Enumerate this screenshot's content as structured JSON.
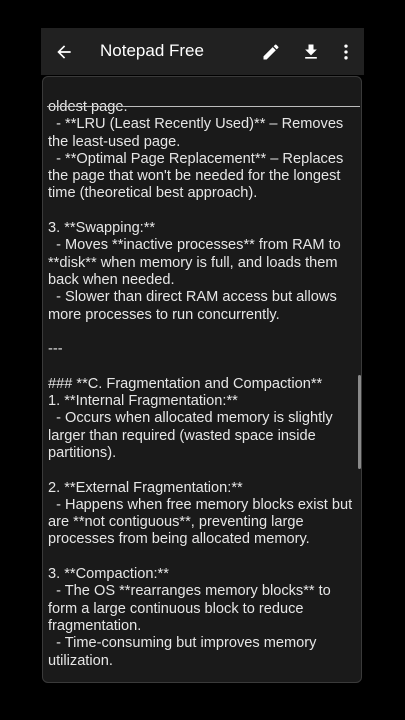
{
  "app_bar": {
    "title": "Notepad Free",
    "icons": {
      "back": "arrow-back-icon",
      "edit": "pencil-icon",
      "download": "download-icon",
      "more": "more-vertical-icon"
    }
  },
  "note": {
    "content": "oldest page.\n  - **LRU (Least Recently Used)** – Removes the least-used page.\n  - **Optimal Page Replacement** – Replaces the page that won't be needed for the longest time (theoretical best approach).\n\n3. **Swapping:**\n  - Moves **inactive processes** from RAM to **disk** when memory is full, and loads them back when needed.\n  - Slower than direct RAM access but allows more processes to run concurrently.\n\n---\n\n### **C. Fragmentation and Compaction**\n1. **Internal Fragmentation:**\n  - Occurs when allocated memory is slightly larger than required (wasted space inside partitions).\n\n2. **External Fragmentation:**\n  - Happens when free memory blocks exist but are **not contiguous**, preventing large processes from being allocated memory.\n\n3. **Compaction:**\n  - The OS **rearranges memory blocks** to form a large continuous block to reduce fragmentation.\n  - Time-consuming but improves memory utilization."
  },
  "colors": {
    "background": "#000000",
    "app_bar": "#212121",
    "card": "#1a1a1a",
    "text": "#e6e6e6"
  }
}
